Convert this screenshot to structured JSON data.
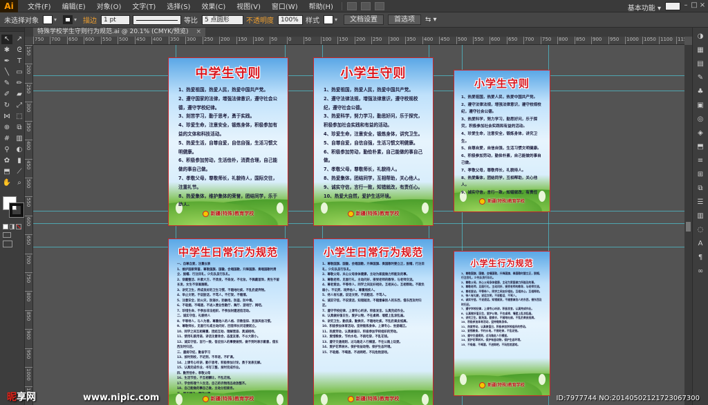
{
  "app": {
    "logo": "Ai",
    "workspace": "基本功能"
  },
  "menu": [
    "文件(F)",
    "编辑(E)",
    "对象(O)",
    "文字(T)",
    "选择(S)",
    "效果(C)",
    "视图(V)",
    "窗口(W)",
    "帮助(H)"
  ],
  "control": {
    "selection": "未选择对象",
    "stroke_label": "描边",
    "stroke_weight": "1 pt",
    "stroke_style": "等比",
    "brush": "5 点圆形",
    "opacity_label": "不透明度",
    "opacity_value": "100%",
    "style_label": "样式",
    "doc_setup": "文档设置",
    "preferences": "首选项"
  },
  "document": {
    "tab_title": "特殊学校学生守则行为规范.ai @ 20.1% (CMYK/预览)",
    "close": "×"
  },
  "rulers": {
    "top": [
      "750",
      "700",
      "650",
      "600",
      "550",
      "500",
      "450",
      "400",
      "350",
      "300",
      "250",
      "200",
      "150",
      "100",
      "50",
      "0",
      "50",
      "100",
      "150",
      "200",
      "250",
      "300",
      "350",
      "400",
      "450",
      "500",
      "550",
      "600",
      "650",
      "700",
      "750",
      "800",
      "850",
      "900",
      "950",
      "1000",
      "1050",
      "1100",
      "1150"
    ],
    "left": [
      "150",
      "200",
      "250",
      "300",
      "350",
      "400",
      "450",
      "500",
      "550",
      "600",
      "650",
      "700",
      "750",
      "800",
      "850",
      "900",
      "950",
      "1000",
      "1050"
    ]
  },
  "boards": [
    {
      "title": "中学生守则",
      "body": "1、热爱祖国，热爱人民，热爱中国共产党。\n2、遵守国家的法律，增强法律意识，遵守社会公德，遵守学校纪律。\n3、刻苦学习，勤于思考，勇于实践。\n4、珍爱生命，注意安全，锻炼身体，积极参加有益的文体和科技活动。\n5、热爱生活，自尊自爱，自信自强，生活习惯文明健康。\n6、积极参加劳动，生活俭朴，消费合理，自己能做的事自己做。\n7、孝敬父母，尊敬师长，礼貌待人，国际交往，注重礼节。\n8、热爱集体，维护集体的荣誉，团结同学，乐于助人。\n9、明辨是非，诚实守信，言行一致，知错就改，有责任心。\n10、热爱大自然，珍惜资源，节约能源，保护环境。",
      "footer": "新疆(特殊)教育学校"
    },
    {
      "title": "小学生守则",
      "body": "1、热爱祖国，热爱人民，热爱中国共产党。\n2、遵守法律法规，增强法律意识，遵守校规校纪，遵守社会公德。\n3、热爱科学，努力学习，勤思好问，乐于探究，积极参加社会实践和有益的活动。\n4、珍爱生命，注意安全，锻炼身体，讲究卫生。\n5、自尊自爱，自信自强，生活习惯文明健康。\n6、积极参加劳动，勤俭朴素，自己能做的事自己做。\n7、孝敬父母，尊敬师长，礼貌待人。\n8、热爱集体，团结同学，互相帮助，关心他人。\n9、诚实守信，言行一致，知错就改，有责任心。\n10、热爱大自然，爱护生活环境。",
      "footer": "新疆(特殊)教育学校"
    },
    {
      "title": "小学生守则",
      "body": "1、热爱祖国，热爱人民，热爱中国共产党。\n2、遵守法律法规，增强法律意识，遵守校规校纪，遵守社会公德。\n3、热爱科学，努力学习，勤思好问，乐于探究，积极参加社会实践和有益的活动。\n4、珍爱生命，注意安全，锻炼身体，讲究卫生。\n5、自尊自爱，自信自强，生活习惯文明健康。\n6、积极参加劳动，勤俭朴素，自己能做的事自己做。\n7、孝敬父母，尊敬师长，礼貌待人。\n8、热爱集体，团结同学，互相帮助，关心他人。\n9、诚实守信，言行一致，知错就改，有责任心。\n10、热爱大自然，爱护生活环境。",
      "footer": "新疆(特殊)教育学校"
    },
    {
      "title": "中学生日常行为规范",
      "body": "一、自尊自爱，注重仪表\n1、维护国家荣誉，尊敬国旗、国徽，会唱国歌，升降国旗、奏唱国歌时肃立、脱帽、行注目礼，少先队员行队礼。\n2、穿戴整洁、朴素大方，不烫发，不染发，不化妆，不佩戴首饰，男生不留长发，女生不穿高跟鞋。\n3、讲究卫生，养成良好的卫生习惯，不随地吐痰，不乱扔废弃物。\n4、举止文明，不说脏话，不骂人，不打架，不赌博。\n5、注意安全，防火灾，防溺水，防触电，防盗，防中毒。\n6、不吸烟，不喝酒，不进入营业性歌厅、舞厅、游戏厅、网吧。\n7、珍惜生命，不参加非法组织，不参加封建迷信活动。\n二、诚实守信，礼貌待人\n8、平等待人，与人为善，尊重他人的人格、宗教信仰、民族风俗习惯。\n9、尊敬师长，见面行礼或主动问好，回答师长问话要起立。\n10、同学之间互相尊重、团结互助、理解宽容、真诚相待。\n11、使用礼貌用语，讲话注意场合，态度友善，不以大欺小。\n12、诚实守信，言行一致，答应别人的事要做到，做不到时表示歉意，借东西及时归还。\n三、遵规守纪，勤奋学习\n13、按时到校，不迟到，不早退，不旷课。\n14、上课专心听讲，勤于思考，积极参加讨论，勇于发表见解。\n15、认真完成作业，书写工整，按时完成作业。\n四、勤劳俭朴，孝敬父母\n16、生活节俭，不互相攀比，不乱花钱。\n17、学会料理个人生活，自己的衣物用品收放整齐。\n18、自己能做的事自己做，主动分担家务。\n五、严于律己，遵守公德\n19、遵守国家法律，不做法律禁止的事。\n20、遵守交通法规，不闯红灯，不违章骑车，过马路走人行横道。\n21、遵守公共秩序，乘公共交通工具主动购票，主动给老幼病残孕让座，爱护公物，保护环境。",
      "footer": "新疆(特殊)教育学校"
    },
    {
      "title": "小学生日常行为规范",
      "body": "1、尊敬国旗、国徽，会唱国歌，升降国旗、奏国歌时要立正，脱帽，行注目礼，少先队员行队礼。\n2、尊敬父母，关心父母身体健康，主动为家庭做力所能及的事。\n3、尊敬老师，见面行礼，主动问好，接受老师的教导，与老师交流。\n4、尊老爱幼，平等待人，同学之间友好相处，互相关心，互相帮助。不欺负弱小，不讥笑、戏弄他人，尊重残疾人。\n5、待人有礼貌，说话文明，不说粗话、不骂人。\n6、诚实守信，不说谎话，知错就改，不随意拿别人的东西，借东西及时归还。\n7、遵守学校纪律，上课专心听讲，积极发言，认真完成作业。\n8、认真做好值日生，爱护公物，不在桌椅、墙壁上乱涂乱画。\n9、讲究卫生，勤洗澡，勤换衣，不随地吐痰，不乱扔果皮纸屑。\n10、积极参加体育活动，坚持锻炼身体，上课专心、坐姿端正。\n11、热爱劳动，认真做值日，积极参加学校组织的劳动。\n12、爱惜粮食，节约水电，不挑吃穿，不乱花钱。\n13、遵守交通规则，过马路走人行横道，不在公路上玩耍。\n14、爱护花草树木，保护有益动物，保护生态环境。\n15、不吸烟、不喝酒，不进网吧，不玩危险游戏。",
      "footer": "新疆(特殊)教育学校"
    },
    {
      "title": "小学生行为规范",
      "body": "1、尊敬国旗、国徽，会唱国歌，升降国旗、奏国歌时要立正，脱帽，行注目礼，少先队员行队礼。\n2、尊敬父母，关心父母身体健康，主动为家庭做力所能及的事。\n3、尊敬老师，见面行礼，主动问好，接受老师的教导，与老师交流。\n4、尊老爱幼，平等待人，同学之间友好相处，互相关心，互相帮助。\n5、待人有礼貌，说话文明，不说粗话、不骂人。\n6、诚实守信，不说谎话，知错就改，不随意拿别人的东西，借东西及时归还。\n7、遵守学校纪律，上课专心听讲，积极发言，认真完成作业。\n8、认真做好值日生，爱护公物，不在桌椅、墙壁上乱涂乱画。\n9、讲究卫生，勤洗澡，勤换衣，不随地吐痰，不乱扔果皮纸屑。\n10、积极参加体育活动，坚持锻炼身体。\n11、热爱劳动，认真做值日，积极参加学校组织的劳动。\n12、爱惜粮食，节约水电，不挑吃穿，不乱花钱。\n13、遵守交通规则，过马路走人行横道。\n14、爱护花草树木，保护有益动物，保护生态环境。\n15、不吸烟、不喝酒，不进网吧，不玩危险游戏。",
      "footer": "新疆(特殊)教育学校"
    }
  ],
  "watermark": {
    "logo_a": "昵",
    "logo_b": "享网",
    "url": "www.nipic.com",
    "id": "ID:7977744 NO:20140502121723067300"
  },
  "colors": {
    "title_red": "#d8131b",
    "guide_cyan": "#4ec9d8",
    "artboard_border": "#c9262a"
  }
}
